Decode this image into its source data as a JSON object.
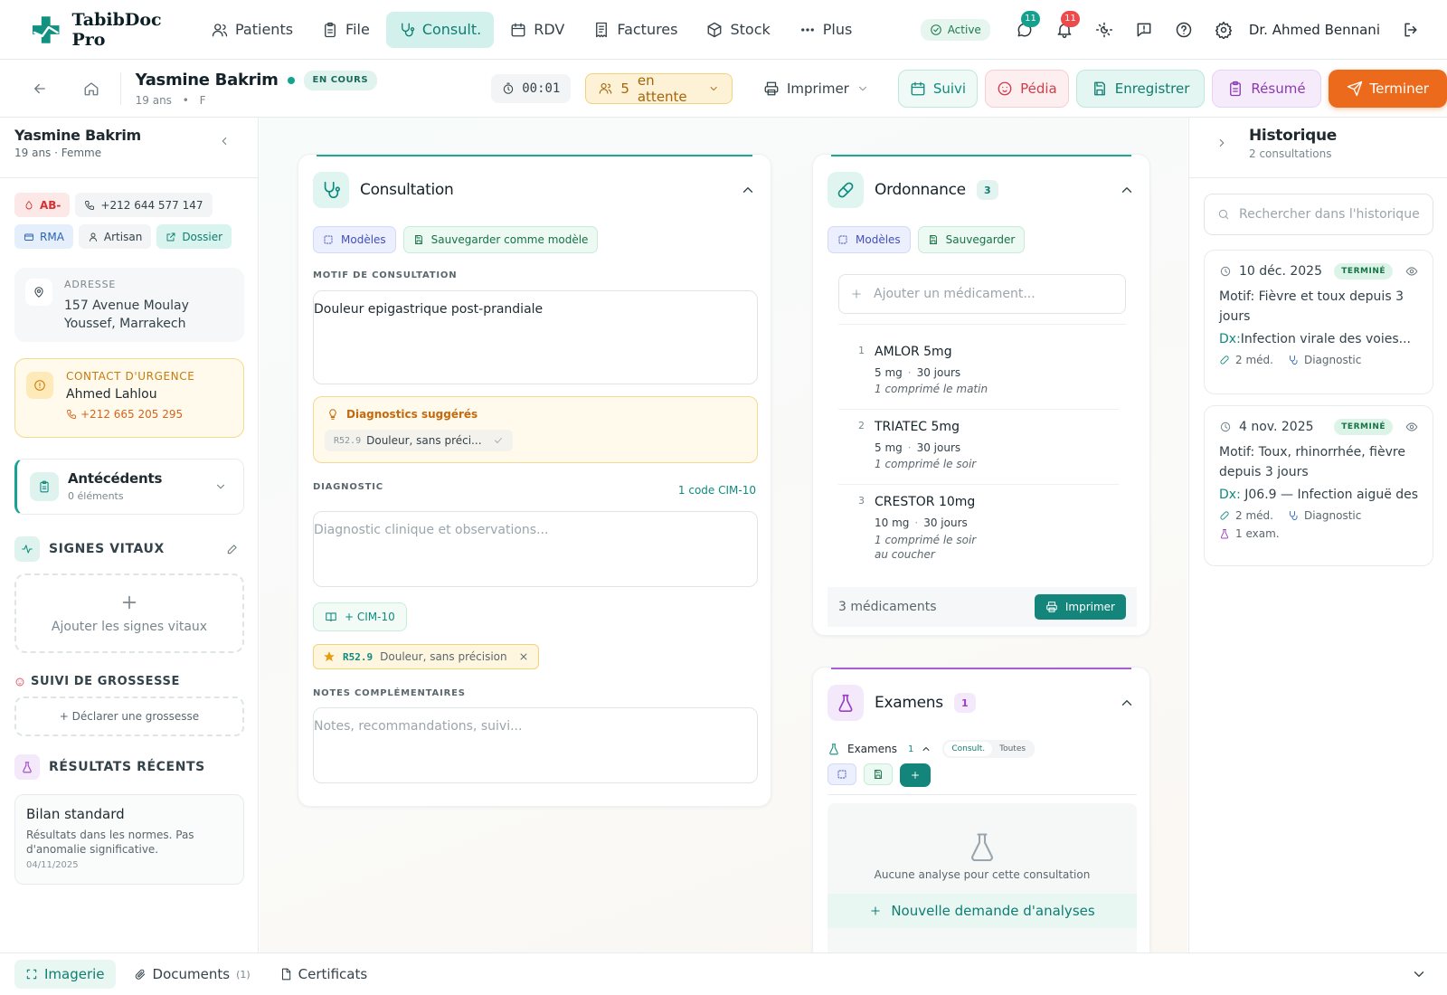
{
  "app": {
    "name": "TabibDoc Pro"
  },
  "nav": {
    "items": [
      {
        "label": "Patients",
        "icon": "users-icon"
      },
      {
        "label": "File",
        "icon": "clipboard-icon"
      },
      {
        "label": "Consult.",
        "icon": "stethoscope-icon",
        "active": true
      },
      {
        "label": "RDV",
        "icon": "calendar-icon"
      },
      {
        "label": "Factures",
        "icon": "receipt-icon"
      },
      {
        "label": "Stock",
        "icon": "package-icon"
      },
      {
        "label": "Plus",
        "icon": "more-icon"
      }
    ],
    "status": "Active",
    "messages_count": "11",
    "notifications_count": "11",
    "doctor": "Dr. Ahmed Bennani"
  },
  "patient_bar": {
    "name": "Yasmine Bakrim",
    "status": "EN COURS",
    "age": "19 ans",
    "sex": "F",
    "timer": "00:01",
    "waiting_count": "5",
    "waiting_label": "en attente",
    "print_label": "Imprimer",
    "buttons": {
      "suivi": "Suivi",
      "pedia": "Pédia",
      "save": "Enregistrer",
      "summary": "Résumé",
      "finish": "Terminer"
    }
  },
  "left": {
    "name": "Yasmine Bakrim",
    "sub": "19 ans · Femme",
    "chips": {
      "blood": "AB-",
      "phone": "+212 644 577 147",
      "insurance": "RMA",
      "job": "Artisan",
      "file": "Dossier"
    },
    "address_label": "ADRESSE",
    "address": "157 Avenue Moulay Youssef, Marrakech",
    "emergency_label": "CONTACT D'URGENCE",
    "emergency_name": "Ahmed Lahlou",
    "emergency_phone": "+212 665 205 295",
    "history_title": "Antécédents",
    "history_count": "0 éléments",
    "vitals_title": "SIGNES VITAUX",
    "vitals_add": "Ajouter les signes vitaux",
    "pregnancy_title": "SUIVI DE GROSSESSE",
    "pregnancy_btn": "+ Déclarer une grossesse",
    "results_title": "RÉSULTATS RÉCENTS",
    "result": {
      "title": "Bilan standard",
      "text": "Résultats dans les normes. Pas d'anomalie significative.",
      "date": "04/11/2025"
    }
  },
  "consultation": {
    "title": "Consultation",
    "models": "Modèles",
    "save_model": "Sauvegarder comme modèle",
    "motif_label": "MOTIF DE CONSULTATION",
    "motif": "Douleur epigastrique post-prandiale",
    "suggest_title": "Diagnostics suggérés",
    "suggest_code": "R52.9",
    "suggest_text": "Douleur, sans préci...",
    "diag_label": "DIAGNOSTIC",
    "diag_codes": "1 code CIM-10",
    "diag_placeholder": "Diagnostic clinique et observations...",
    "cim_btn": "+ CIM-10",
    "selected_code": "R52.9",
    "selected_text": "Douleur, sans précision",
    "notes_label": "NOTES COMPLÉMENTAIRES",
    "notes_placeholder": "Notes, recommandations, suivi..."
  },
  "ordonnance": {
    "title": "Ordonnance",
    "count": "3",
    "models": "Modèles",
    "save": "Sauvegarder",
    "add_placeholder": "Ajouter un médicament...",
    "meds": [
      {
        "num": "1",
        "name": "AMLOR 5mg",
        "dose": "5 mg",
        "duration": "30 jours",
        "posology": "1 comprimé le matin"
      },
      {
        "num": "2",
        "name": "TRIATEC 5mg",
        "dose": "5 mg",
        "duration": "30 jours",
        "posology": "1 comprimé le soir"
      },
      {
        "num": "3",
        "name": "CRESTOR 10mg",
        "dose": "10 mg",
        "duration": "30 jours",
        "posology": "1 comprimé le soir au coucher"
      }
    ],
    "total": "3 médicaments",
    "print": "Imprimer"
  },
  "examens": {
    "title": "Examens",
    "count": "1",
    "sub_title": "Examens",
    "sub_count": "1",
    "filter_consult": "Consult.",
    "filter_all": "Toutes",
    "empty": "Aucune analyse pour cette consultation",
    "new_request": "Nouvelle demande d'analyses"
  },
  "history": {
    "title": "Historique",
    "count": "2 consultations",
    "search_placeholder": "Rechercher dans l'historique...",
    "entries": [
      {
        "date": "10 déc. 2025",
        "status": "TERMINÉ",
        "motif_label": "Motif:",
        "motif": "Fièvre et toux depuis 3 jours",
        "dx_label": "Dx:",
        "dx": "Infection virale des voies...",
        "meds": "2 méd.",
        "diag": "Diagnostic"
      },
      {
        "date": "4 nov. 2025",
        "status": "TERMINÉ",
        "motif_label": "Motif:",
        "motif": "Toux, rhinorrhée, fièvre depuis 3 jours",
        "dx_label": "Dx:",
        "dx": "J06.9 — Infection aiguë des...",
        "meds": "2 méd.",
        "diag": "Diagnostic",
        "exams": "1 exam."
      }
    ]
  },
  "bottom": {
    "imaging": "Imagerie",
    "documents": "Documents",
    "documents_count": "(1)",
    "certificates": "Certificats"
  },
  "colors": {
    "brand": "#0f8a7e",
    "accent_orange": "#ec6a1c",
    "warning": "#f3d27c",
    "danger": "#e03c3c"
  }
}
